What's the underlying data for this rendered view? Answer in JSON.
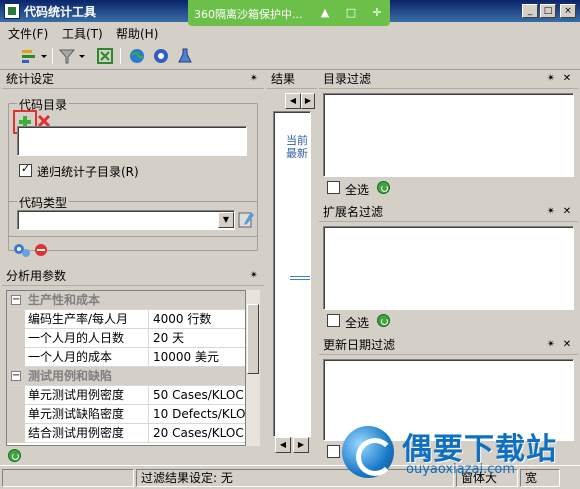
{
  "window": {
    "title": "代码统计工具",
    "buttons": [
      "_",
      "□",
      "×"
    ]
  },
  "sandbox": {
    "text": "360隔离沙箱保护中..."
  },
  "menu": {
    "items": [
      "文件(F)",
      "工具(T)",
      "帮助(H)"
    ]
  },
  "left_panel": {
    "title": "统计设定",
    "code_dir_label": "代码目录",
    "recursive_label": "递归统计子目录(R)",
    "recursive_checked": true,
    "code_type_label": "代码类型"
  },
  "params_panel": {
    "title": "分析用参数",
    "rows": [
      {
        "category": true,
        "key": "生产性和成本",
        "value": ""
      },
      {
        "category": false,
        "key": "编码生产率/每人月",
        "value": "4000 行数"
      },
      {
        "category": false,
        "key": "一个人月的人日数",
        "value": "20 天"
      },
      {
        "category": false,
        "key": "一个人月的成本",
        "value": "10000 美元"
      },
      {
        "category": true,
        "key": "测试用例和缺陷",
        "value": ""
      },
      {
        "category": false,
        "key": "单元测试用例密度",
        "value": "50 Cases/KLOC"
      },
      {
        "category": false,
        "key": "单元测试缺陷密度",
        "value": "10 Defects/KLOC"
      },
      {
        "category": false,
        "key": "结合测试用例密度",
        "value": "20 Cases/KLOC"
      }
    ]
  },
  "result_panel": {
    "title": "结果",
    "text1": "当前",
    "text2": "最新"
  },
  "dir_filter": {
    "title": "目录过滤",
    "select_all": "全选"
  },
  "ext_filter": {
    "title": "扩展名过滤",
    "select_all": "全选"
  },
  "date_filter": {
    "title": "更新日期过滤",
    "select_all": "全选"
  },
  "status": {
    "filter_result": "过滤结果设定: 无",
    "cell2": "窗体大",
    "cell3": "宽"
  },
  "watermark": {
    "main": "偶要下载站",
    "sub": "ouyaoxiazai.com"
  },
  "colors": {
    "title_bar": "#0a246a",
    "sandbox": "#6cc04a",
    "accent_red": "#e03030"
  }
}
